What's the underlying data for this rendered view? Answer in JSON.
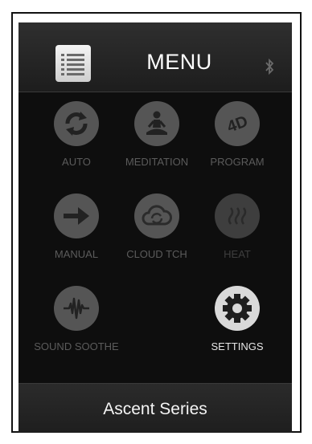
{
  "header": {
    "title": "MENU",
    "menu_icon": "list-icon",
    "status_icon": "bluetooth-icon"
  },
  "modes": [
    {
      "label": "AUTO",
      "icon": "refresh-icon",
      "state": "normal"
    },
    {
      "label": "MEDITATION",
      "icon": "meditation-icon",
      "state": "normal"
    },
    {
      "label": "PROGRAM",
      "icon": "4d-icon",
      "state": "normal"
    },
    {
      "label": "MANUAL",
      "icon": "arrow-right-icon",
      "state": "normal"
    },
    {
      "label": "CLOUD TCH",
      "icon": "cloud-icon",
      "state": "normal"
    },
    {
      "label": "HEAT",
      "icon": "heat-icon",
      "state": "dim"
    },
    {
      "label": "SOUND SOOTHE",
      "icon": "sound-wave-icon",
      "state": "normal"
    },
    {
      "label": "SETTINGS",
      "icon": "gear-icon",
      "state": "active"
    }
  ],
  "footer": {
    "title": "Ascent Series"
  },
  "colors": {
    "background": "#0e0e0e",
    "tile": "#555555",
    "tile_active": "#d9d9d9",
    "label": "#5b5b5b",
    "label_active": "#e6e6e6"
  }
}
